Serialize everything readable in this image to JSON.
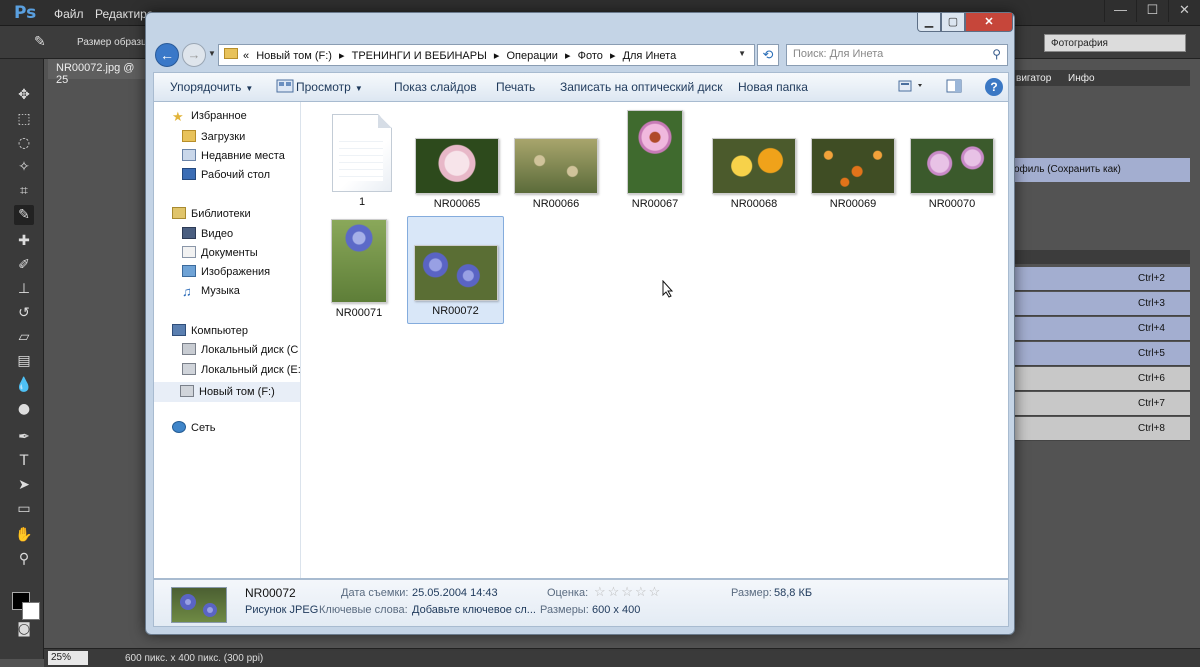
{
  "ps": {
    "logo": "Ps",
    "menu": [
      "Файл",
      "Редактиро"
    ],
    "options_label": "Размер образца",
    "workspace": "Фотография",
    "doc_tab": "NR00072.jpg @ 25",
    "zoom": "25%",
    "doc_info": "600 пикс. x 400 пикс. (300 ppi)",
    "panel_tabs": [
      "вигатор",
      "Инфо"
    ],
    "panel_text": "офиль (Сохранить как)",
    "shortcuts": [
      "Ctrl+2",
      "Ctrl+3",
      "Ctrl+4",
      "Ctrl+5",
      "Ctrl+6",
      "Ctrl+7",
      "Ctrl+8"
    ]
  },
  "explorer": {
    "address": {
      "overflow": "«",
      "crumbs": [
        "Новый том (F:)",
        "ТРЕНИНГИ И ВЕБИНАРЫ",
        "Операции",
        "Фото",
        "Для Инета"
      ],
      "sep": "▸"
    },
    "search_placeholder": "Поиск: Для Инета",
    "commands": {
      "organize": "Упорядочить",
      "view": "Просмотр",
      "slideshow": "Показ слайдов",
      "print": "Печать",
      "burn": "Записать на оптический диск",
      "new_folder": "Новая папка"
    },
    "nav": {
      "favorites": "Избранное",
      "downloads": "Загрузки",
      "recent": "Недавние места",
      "desktop": "Рабочий стол",
      "libraries": "Библиотеки",
      "video": "Видео",
      "documents": "Документы",
      "images": "Изображения",
      "music": "Музыка",
      "computer": "Компьютер",
      "disk_c": "Локальный диск (C",
      "disk_e": "Локальный диск (E:",
      "disk_f": "Новый том (F:)",
      "network": "Сеть"
    },
    "files": [
      {
        "name": "1",
        "kind": "doc"
      },
      {
        "name": "NR00065",
        "kind": "image",
        "colors": [
          "#2d4a1c",
          "#e8b8c8",
          "#f7e4ea"
        ]
      },
      {
        "name": "NR00066",
        "kind": "image",
        "colors": [
          "#5b6b3a",
          "#a8a56c",
          "#d0c39a"
        ]
      },
      {
        "name": "NR00067",
        "kind": "image",
        "colors": [
          "#3f6a2e",
          "#c77ab6",
          "#f0b8de"
        ]
      },
      {
        "name": "NR00068",
        "kind": "image",
        "colors": [
          "#4b5a2c",
          "#f0a21a",
          "#f7d24a"
        ]
      },
      {
        "name": "NR00069",
        "kind": "image",
        "colors": [
          "#3f4d24",
          "#e1731a",
          "#f2a23a"
        ]
      },
      {
        "name": "NR00070",
        "kind": "image",
        "colors": [
          "#3b5a2c",
          "#c98ac8",
          "#e8c2e6"
        ]
      },
      {
        "name": "NR00071",
        "kind": "image",
        "colors": [
          "#7a9a4a",
          "#5c6ac8",
          "#a6b0e8"
        ]
      },
      {
        "name": "NR00072",
        "kind": "image",
        "colors": [
          "#5a6e34",
          "#5a64c4",
          "#98a0e4"
        ]
      }
    ],
    "details": {
      "name": "NR00072",
      "type": "Рисунок JPEG",
      "date_label": "Дата съемки:",
      "date_value": "25.05.2004 14:43",
      "keywords_label": "Ключевые слова:",
      "keywords_value": "Добавьте ключевое сл...",
      "rating_label": "Оценка:",
      "rating_value": "☆☆☆☆☆",
      "dims_label": "Размеры:",
      "dims_value": "600 x 400",
      "size_label": "Размер:",
      "size_value": "58,8 КБ"
    }
  }
}
